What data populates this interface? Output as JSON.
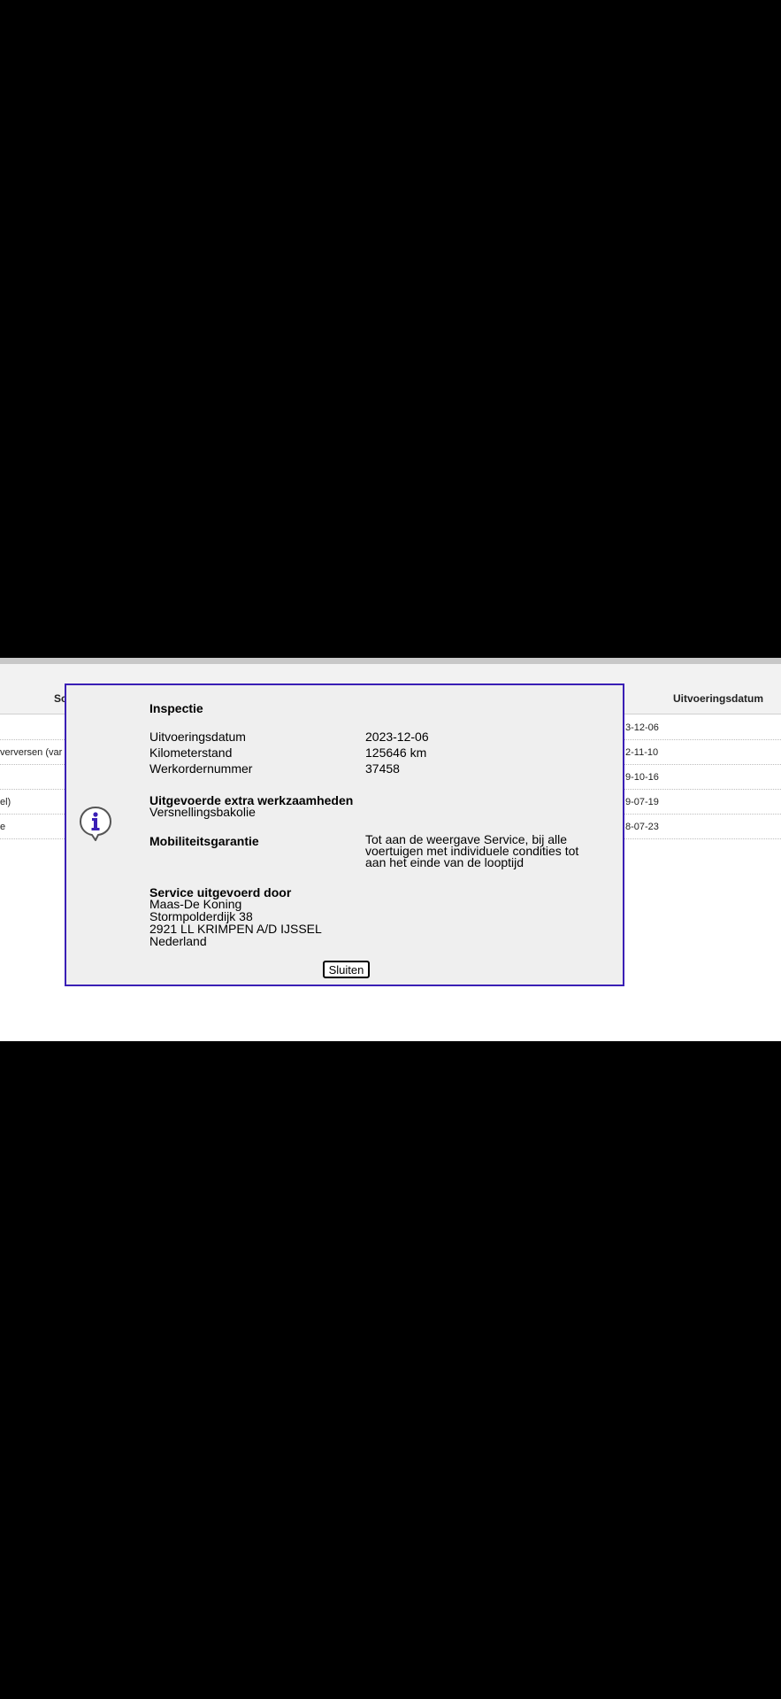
{
  "background_table": {
    "headers": {
      "left": "Sc",
      "right": "Uitvoeringsdatum"
    },
    "rows": [
      {
        "left": "",
        "right": "3-12-06"
      },
      {
        "left": "verversen (var",
        "right": "2-11-10"
      },
      {
        "left": "",
        "right": "9-10-16"
      },
      {
        "left": "el)",
        "right": "9-07-19"
      },
      {
        "left": "e",
        "right": "8-07-23"
      }
    ]
  },
  "modal": {
    "title": "Inspectie",
    "fields": [
      {
        "label": "Uitvoeringsdatum",
        "value": "2023-12-06"
      },
      {
        "label": "Kilometerstand",
        "value": "125646 km"
      },
      {
        "label": "Werkordernummer",
        "value": "37458"
      }
    ],
    "extra_work": {
      "title": "Uitgevoerde extra werkzaamheden",
      "value": "Versnellingsbakolie"
    },
    "mobility": {
      "title": "Mobiliteitsgarantie",
      "lines": [
        "Tot aan de weergave Service, bij alle",
        "voertuigen met individuele condities tot",
        "aan het einde van de looptijd"
      ]
    },
    "service": {
      "title": "Service uitgevoerd door",
      "lines": [
        "Maas-De Koning",
        "Stormpolderdijk 38",
        "2921 LL KRIMPEN A/D IJSSEL",
        "Nederland"
      ]
    },
    "close_label": "Sluiten"
  },
  "colors": {
    "modal_border": "#3a1fb5",
    "modal_bg": "#efefef",
    "icon_color": "#3a1fb5"
  },
  "icons": {
    "info": "info-speech-bubble-icon"
  }
}
